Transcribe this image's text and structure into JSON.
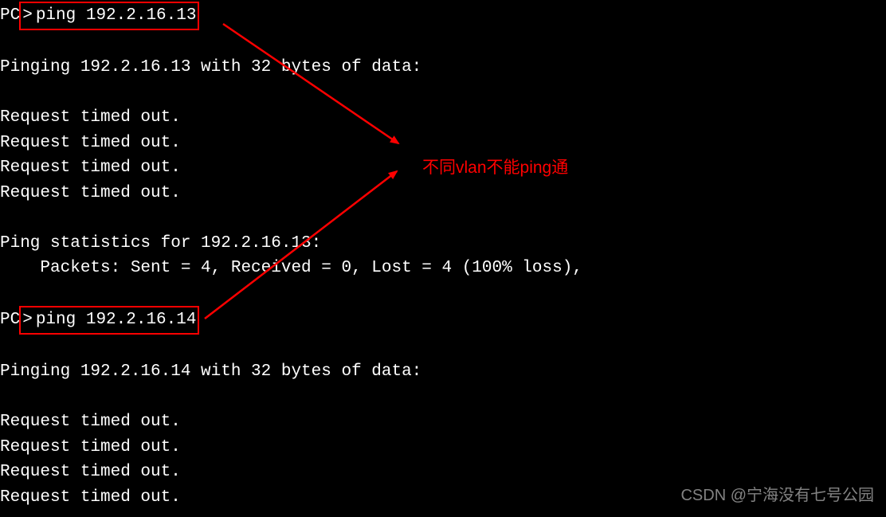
{
  "terminal": {
    "prompt1_prefix": "PC",
    "cmd1": "ping 192.2.16.13",
    "blank": "",
    "pinging1": "Pinging 192.2.16.13 with 32 bytes of data:",
    "timeout1": "Request timed out.",
    "timeout2": "Request timed out.",
    "timeout3": "Request timed out.",
    "timeout4": "Request timed out.",
    "stats1_header": "Ping statistics for 192.2.16.13:",
    "stats1_detail": "    Packets: Sent = 4, Received = 0, Lost = 4 (100% loss),",
    "prompt2_prefix": "PC",
    "cmd2": "ping 192.2.16.14",
    "pinging2": "Pinging 192.2.16.14 with 32 bytes of data:",
    "timeout5": "Request timed out.",
    "timeout6": "Request timed out.",
    "timeout7": "Request timed out.",
    "timeout8": "Request timed out."
  },
  "annotation": {
    "text": "不同vlan不能ping通"
  },
  "watermark": {
    "text": "CSDN @宁海没有七号公园"
  },
  "colors": {
    "highlight": "#ff0000",
    "bg": "#000000",
    "fg": "#ffffff"
  }
}
